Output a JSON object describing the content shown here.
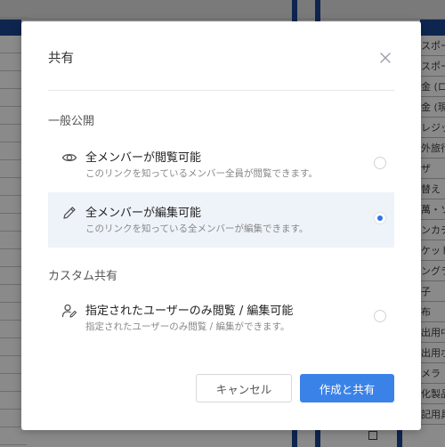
{
  "background": {
    "right_column_cells": [
      "スポー",
      "スポー",
      "金 (ロ",
      "金 (現",
      "レジッ",
      "外旅行",
      "ザ",
      "替え",
      "萬・ソ",
      "ンカチ",
      "ケット",
      "ングラ",
      "子",
      "布",
      "出用中",
      "出用ポ",
      "メラ",
      "化製品",
      "記用具"
    ]
  },
  "dialog": {
    "title": "共有",
    "close_icon": "close-icon",
    "public_section_label": "一般公開",
    "custom_section_label": "カスタム共有",
    "options": [
      {
        "icon": "eye-icon",
        "title": "全メンバーが閲覧可能",
        "description": "このリンクを知っているメンバー全員が閲覧できます。",
        "selected": false
      },
      {
        "icon": "pencil-icon",
        "title": "全メンバーが編集可能",
        "description": "このリンクを知っている全メンバーが編集できます。",
        "selected": true
      },
      {
        "icon": "user-edit-icon",
        "title": "指定されたユーザーのみ閲覧 / 編集可能",
        "description": "指定されたユーザーのみ閲覧 / 編集ができます。",
        "selected": false
      }
    ],
    "cancel_label": "キャンセル",
    "submit_label": "作成と共有"
  },
  "colors": {
    "accent": "#3b82e8",
    "selected_row": "#eef3f9",
    "overlay": "#8a8a8a",
    "navy": "#0e2550"
  }
}
